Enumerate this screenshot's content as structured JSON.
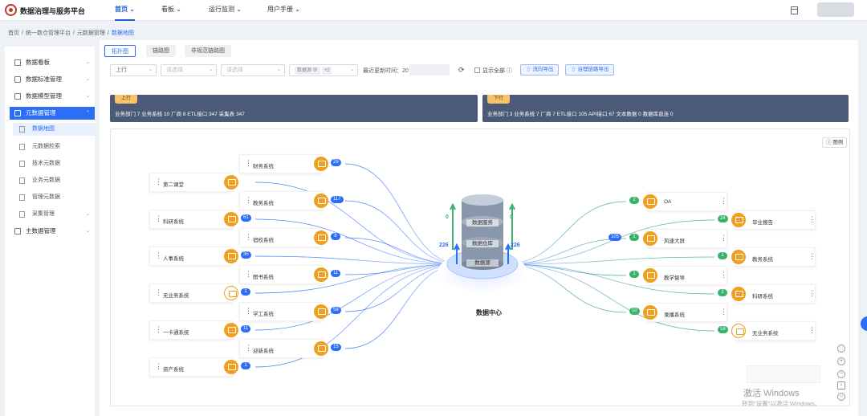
{
  "app": {
    "title": "数据治理与服务平台"
  },
  "topnav": [
    {
      "label": "首页",
      "active": true
    },
    {
      "label": "看板",
      "active": false
    },
    {
      "label": "运行监测",
      "active": false
    },
    {
      "label": "用户手册",
      "active": false
    }
  ],
  "breadcrumb": [
    "首页",
    "/",
    "统一数仓管理平台",
    "/",
    "元数据管理",
    "/",
    "数据地图"
  ],
  "sidebar": {
    "items": [
      {
        "label": "数据看板",
        "type": "group"
      },
      {
        "label": "数据标准管理",
        "type": "group"
      },
      {
        "label": "数据模型管理",
        "type": "group"
      },
      {
        "label": "元数据管理",
        "type": "group",
        "active": true
      },
      {
        "label": "数据地图",
        "type": "sub",
        "active": true
      },
      {
        "label": "元数据检索",
        "type": "sub"
      },
      {
        "label": "技术元数据",
        "type": "sub"
      },
      {
        "label": "业务元数据",
        "type": "sub"
      },
      {
        "label": "管理元数据",
        "type": "sub"
      },
      {
        "label": "采集管理",
        "type": "sub"
      },
      {
        "label": "主数据管理",
        "type": "group"
      }
    ]
  },
  "tabs": [
    {
      "label": "拓扑图",
      "active": true
    },
    {
      "label": "链路图",
      "active": false
    },
    {
      "label": "非规范链路图",
      "active": false
    }
  ],
  "filters": {
    "direction": "上行",
    "select2_placeholder": "请选择",
    "select3_placeholder": "请选择",
    "select4_tag": "数据源",
    "select4_more": "+2",
    "update_label": "最近更新时间：20",
    "show_all_label": "显示全部",
    "btn_export_flow": "流向导出",
    "btn_export_governance": "治理链路导出"
  },
  "upstream": {
    "flag": "上行",
    "stats": "业务部门 7   业务系统 10   厂商 8   ETL接口 347   采集表 347"
  },
  "downstream": {
    "flag": "下行",
    "stats": "业务部门 3   业务系统 7   厂商 7   ETL接口 105   API接口 67   文本数据 0   数据库直连 0"
  },
  "map": {
    "legend": "图例",
    "center_label": "数据中心",
    "db_layers": [
      "数据服务",
      "数据仓库",
      "数据源"
    ],
    "counts": {
      "left_up": "0",
      "left_down": "226",
      "right_up": "0",
      "right_down": "226"
    },
    "left_inner": [
      {
        "label": "财务系统",
        "count": "29"
      },
      {
        "label": "教务系统",
        "count": "117"
      },
      {
        "label": "宿校系统",
        "count": "8"
      },
      {
        "label": "图书系统",
        "count": "11"
      },
      {
        "label": "学工系统",
        "count": "58"
      },
      {
        "label": "迎新系统",
        "count": "15"
      }
    ],
    "left_outer": [
      {
        "label": "第二课堂",
        "count": ""
      },
      {
        "label": "科研系统",
        "count": "61"
      },
      {
        "label": "人事系统",
        "count": "35"
      },
      {
        "label": "无业务系统",
        "count": "1"
      },
      {
        "label": "一卡通系统",
        "count": "11"
      },
      {
        "label": "资产系统",
        "count": "1"
      }
    ],
    "right_inner": [
      {
        "label": "OA",
        "count": "2",
        "extra": ""
      },
      {
        "label": "风速大屏",
        "count": "1",
        "extra": "105"
      },
      {
        "label": "教学督导",
        "count": "1",
        "extra": ""
      },
      {
        "label": "录播系统",
        "count": "10",
        "extra": ""
      }
    ],
    "right_outer": [
      {
        "label": "毕业报告",
        "count": "24"
      },
      {
        "label": "教务系统",
        "count": "1"
      },
      {
        "label": "科研系统",
        "count": "2"
      },
      {
        "label": "无业务系统",
        "count": "18"
      }
    ]
  },
  "watermark": {
    "line1": "激活 Windows",
    "line2": "转到\"设置\"以激活 Windows。"
  },
  "colors": {
    "accent": "#2c6ff6",
    "node_icon": "#f0a020",
    "panel": "#4a5a78",
    "green": "#39b36b"
  }
}
